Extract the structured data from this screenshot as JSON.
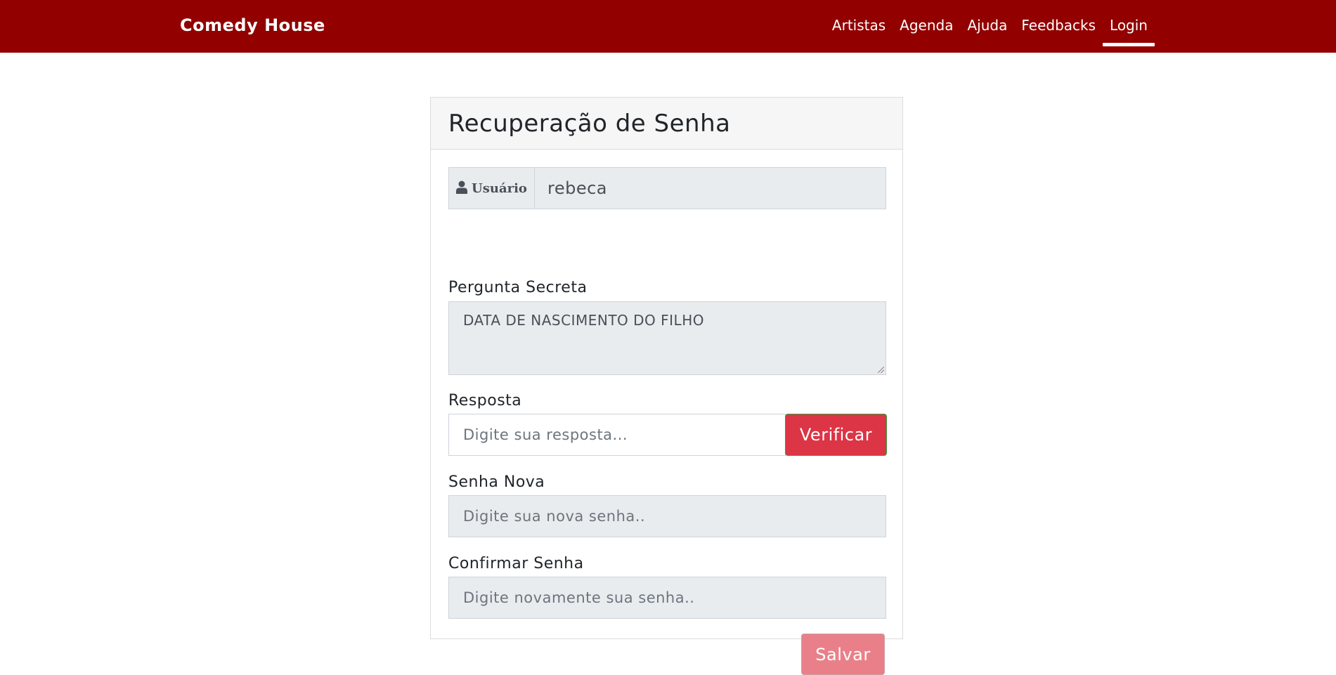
{
  "navbar": {
    "brand": "Comedy House",
    "items": [
      {
        "label": "Artistas"
      },
      {
        "label": "Agenda"
      },
      {
        "label": "Ajuda"
      },
      {
        "label": "Feedbacks"
      },
      {
        "label": "Login",
        "active": true
      }
    ],
    "background_color": "#920000"
  },
  "card": {
    "title": "Recuperação de Senha",
    "user": {
      "icon": "user-icon",
      "label": "Usuário",
      "value": "rebeca"
    },
    "secret_question": {
      "label": "Pergunta Secreta",
      "value": "DATA DE NASCIMENTO DO FILHO"
    },
    "answer": {
      "label": "Resposta",
      "placeholder": "Digite sua resposta...",
      "button_label": "Verificar"
    },
    "new_password": {
      "label": "Senha Nova",
      "placeholder": "Digite sua nova senha.."
    },
    "confirm_password": {
      "label": "Confirmar Senha",
      "placeholder": "Digite novamente sua senha.."
    },
    "save_label": "Salvar"
  },
  "colors": {
    "primary_red": "#dc3545",
    "disabled_red": "#e98089",
    "readonly_bg": "#e9ecef"
  }
}
